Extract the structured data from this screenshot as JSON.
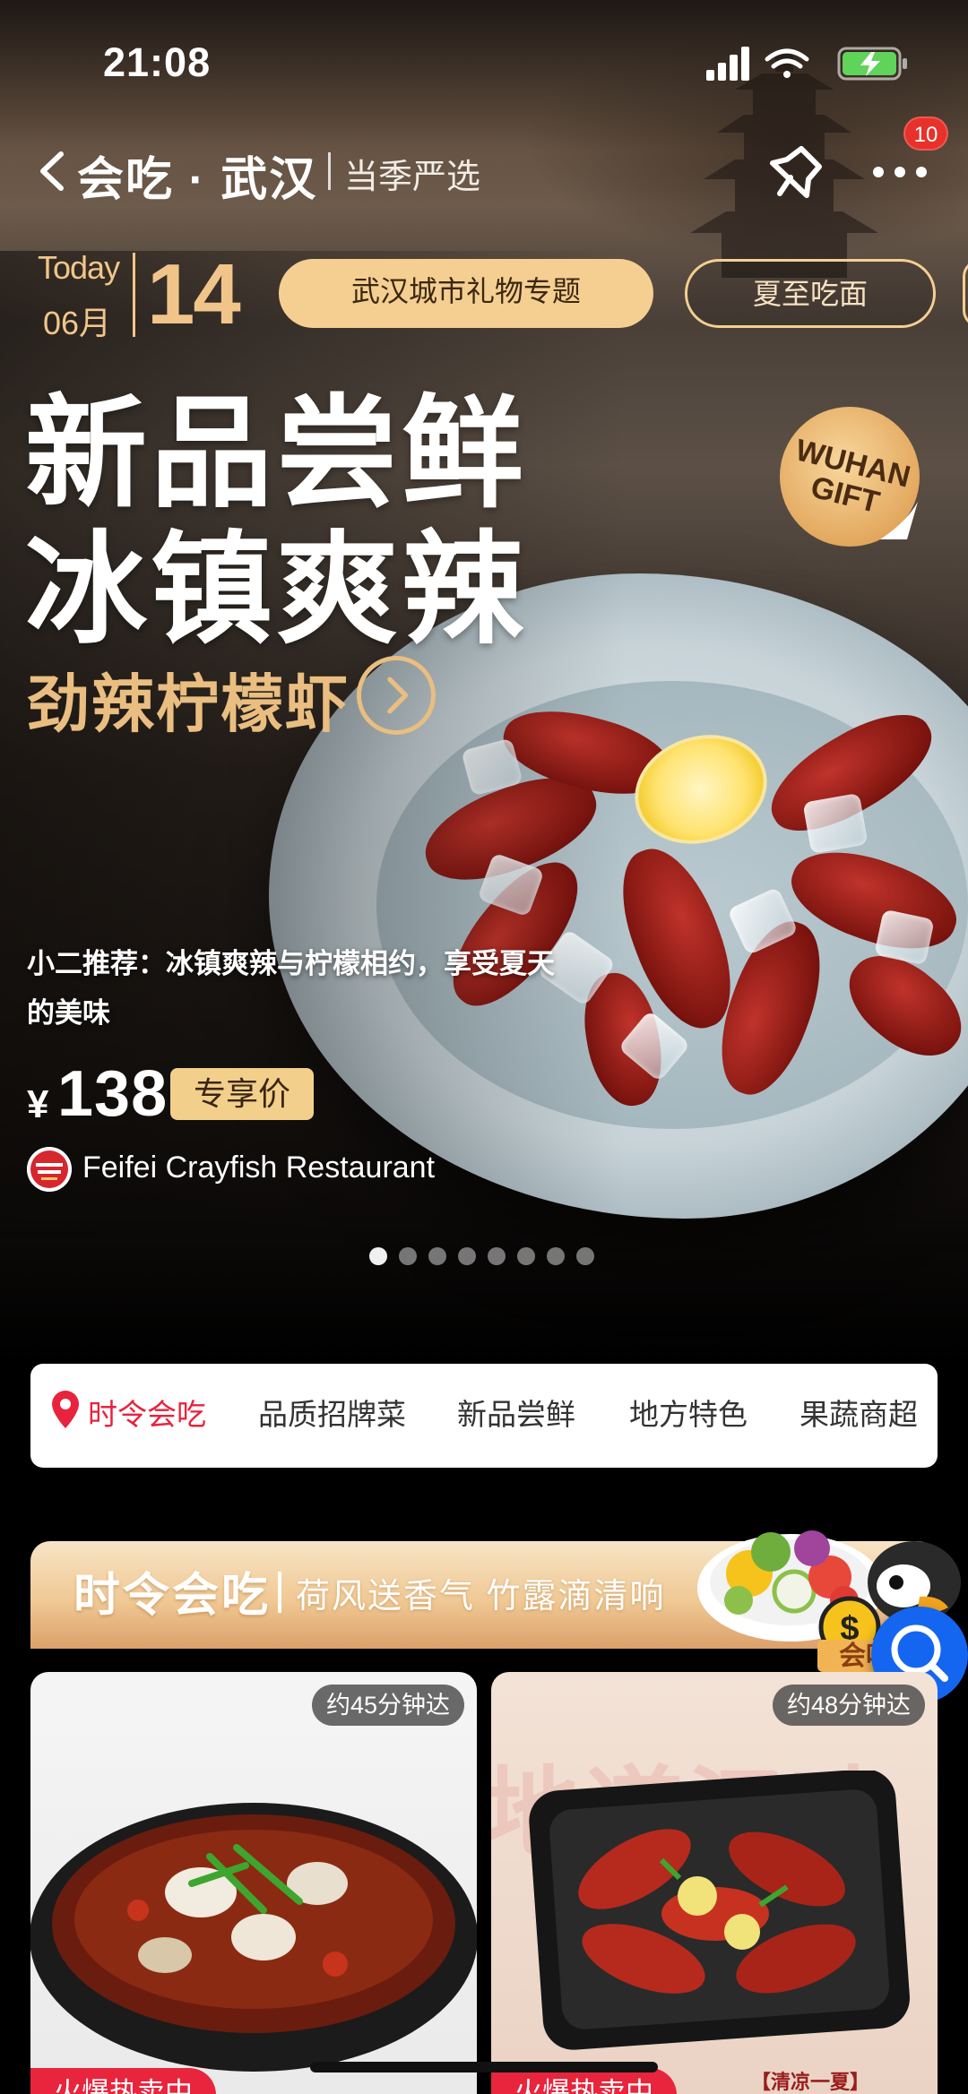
{
  "status_bar": {
    "time": "21:08"
  },
  "nav": {
    "brand": "会吃 · 武汉",
    "subtitle": "当季严选",
    "badge_count": "10"
  },
  "date": {
    "today_label": "Today",
    "month": "06月",
    "day": "14"
  },
  "topic_chips": [
    "武汉城市礼物专题",
    "夏至吃面"
  ],
  "hero": {
    "headline_line1": "新品尝鲜",
    "headline_line2": "冰镇爽辣",
    "subheadline": "劲辣柠檬虾",
    "gift_badge": "WUHAN GIFT",
    "recommendation": "小二推荐：冰镇爽辣与柠檬相约，享受夏天的美味",
    "currency": "¥",
    "price": "138",
    "price_tag": "专享价",
    "restaurant": "Feifei Crayfish Restaurant",
    "carousel": {
      "count": 8,
      "active": 0
    }
  },
  "categories": [
    {
      "label": "时令会吃",
      "active": true
    },
    {
      "label": "品质招牌菜",
      "active": false
    },
    {
      "label": "新品尝鲜",
      "active": false
    },
    {
      "label": "地方特色",
      "active": false
    },
    {
      "label": "果蔬商超",
      "active": false
    }
  ],
  "section": {
    "title": "时令会吃",
    "subtitle": "荷风送香气 竹露滴清响",
    "mascot_text": "会吃"
  },
  "products": [
    {
      "eta": "约45分钟达",
      "tag": "火爆热卖中"
    },
    {
      "eta": "约48分钟达",
      "tag": "火爆热卖中",
      "bg_text": "地道汉味",
      "note": "【清凉一夏】"
    }
  ],
  "colors": {
    "gold": "#f5cf92",
    "accent_red": "#e7233d",
    "fab_blue": "#1466f0"
  },
  "icons": {
    "back": "chevron-left-icon",
    "pin": "pin-icon",
    "more": "more-icon",
    "location": "location-pin-icon",
    "search": "search-icon"
  }
}
